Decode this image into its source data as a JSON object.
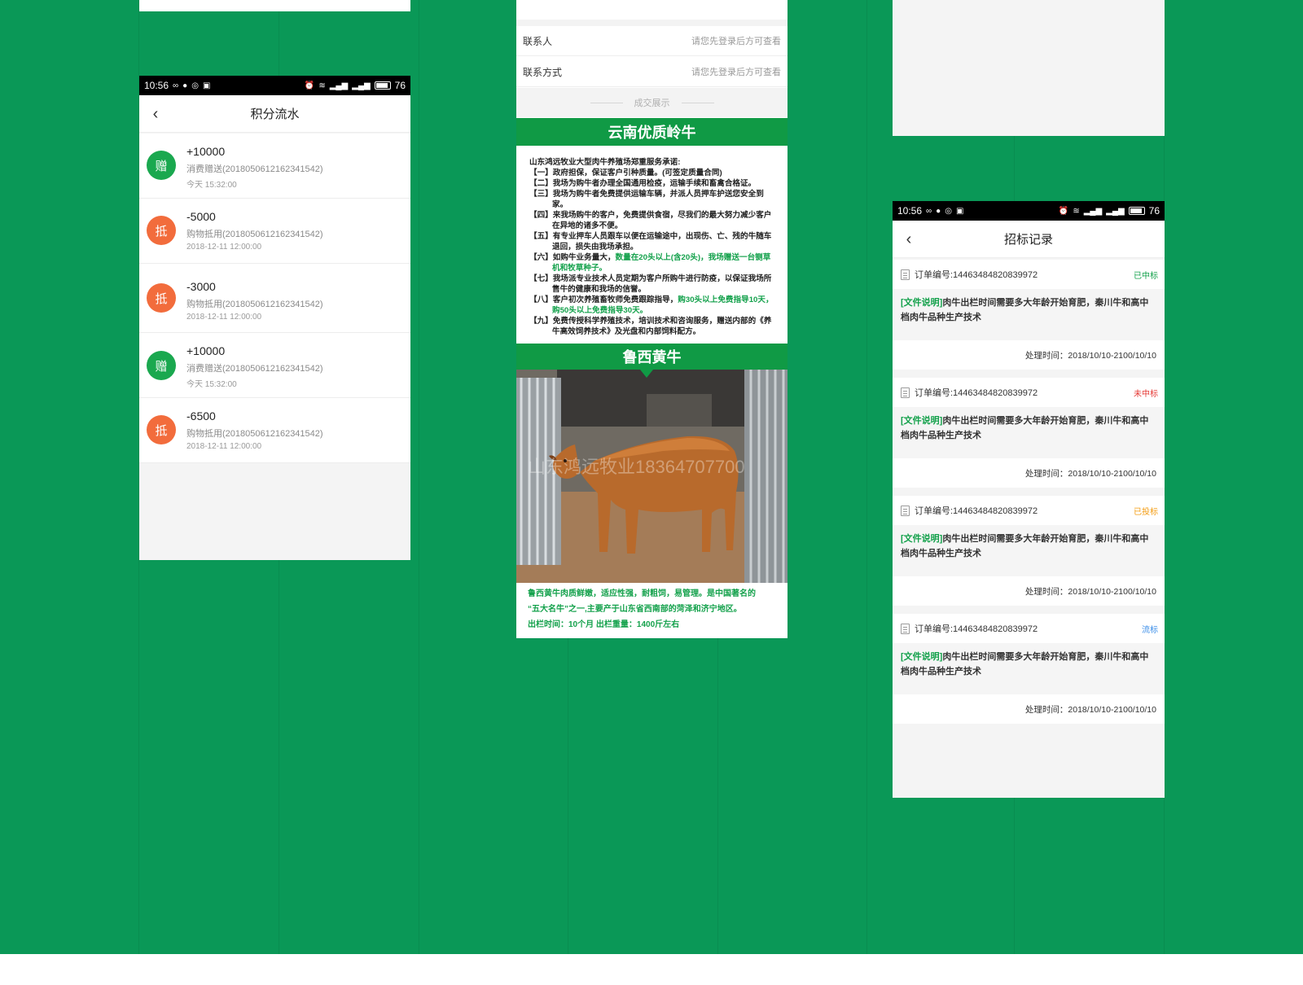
{
  "colors": {
    "background": "#0a9857",
    "accent_green": "#13a14b",
    "badge_gift": "#1aa84f",
    "badge_deduct": "#f26c3c",
    "status_won": "#13a14b",
    "status_lost": "#e53935",
    "status_bid": "#f39c12",
    "status_failed": "#3b8ee8"
  },
  "status_bar": {
    "time": "10:56",
    "battery": "76",
    "left_icons": [
      "infinity-icon",
      "chat-bubble-icon",
      "sync-icon",
      "image-icon"
    ],
    "right_icons": [
      "alarm-icon",
      "wifi-icon",
      "signal-icon",
      "signal-icon",
      "battery-icon"
    ]
  },
  "points_panel": {
    "title": "积分流水",
    "items": [
      {
        "badge": "赠",
        "amount": "+10000",
        "desc": "消费赠送(2018050612162341542)",
        "time": "今天 15:32:00",
        "type": "gift"
      },
      {
        "badge": "抵",
        "amount": "-5000",
        "desc": "购物抵用(2018050612162341542)",
        "time": "2018-12-11 12:00:00",
        "type": "deduct"
      },
      {
        "badge": "抵",
        "amount": "-3000",
        "desc": "购物抵用(2018050612162341542)",
        "time": "2018-12-11 12:00:00",
        "type": "deduct"
      },
      {
        "badge": "赠",
        "amount": "+10000",
        "desc": "消费赠送(2018050612162341542)",
        "time": "今天 15:32:00",
        "type": "gift"
      },
      {
        "badge": "抵",
        "amount": "-6500",
        "desc": "购物抵用(2018050612162341542)",
        "time": "2018-12-11 12:00:00",
        "type": "deduct"
      }
    ]
  },
  "detail_panel": {
    "contact_label": "联系人",
    "contact_value": "请您先登录后方可查看",
    "method_label": "联系方式",
    "method_value": "请您先登录后方可查看",
    "section_label": "成交展示",
    "banner1": "云南优质岭牛",
    "promise_lead": "山东鸿远牧业大型肉牛养殖场郑重服务承诺:",
    "promises": [
      {
        "no": "【一】",
        "text": "政府担保，保证客户引种质量。(可签定质量合同)"
      },
      {
        "no": "【二】",
        "text": "我场为购牛者办理全国通用检疫，运输手续和畜禽合格证。"
      },
      {
        "no": "【三】",
        "text": "我场为购牛者免费提供运输车辆，并派人员押车护送您安全到家。"
      },
      {
        "no": "【四】",
        "text": "来我场购牛的客户，免费提供食宿，尽我们的最大努力减少客户在异地的诸多不便。"
      },
      {
        "no": "【五】",
        "text": "有专业押车人员跟车以便在运输途中，出现伤、亡、残的牛随车退回，损失由我场承担。"
      },
      {
        "no": "【六】",
        "text": "如购牛业务量大，",
        "hl": "数量在20头以上(含20头)，我场赠送一台铡草机和牧草种子。"
      },
      {
        "no": "【七】",
        "text": "我场派专业技术人员定期为客户所购牛进行防疫，以保证我场所售牛的健康和我场的信誉。"
      },
      {
        "no": "【八】",
        "text": "客户初次养殖畜牧师免费跟踪指导，",
        "hl": "购30头以上免费指导10天，购50头以上免费指导30天。"
      },
      {
        "no": "【九】",
        "text": "免费传授科学养殖技术，培训技术和咨询服务，赠送内部的《养牛高效饲养技术》及光盘和内部饲料配方。"
      }
    ],
    "banner2": "鲁西黄牛",
    "watermark": "山东鸿远牧业18364707700",
    "caption_line1": "鲁西黄牛肉质鲜嫩，适应性强，耐粗饲，易管理。是中国著名的",
    "caption_line2": "“五大名牛”之一,主要产于山东省西南部的菏泽和济宁地区。",
    "caption_line3": "出栏时间：10个月     出栏重量：1400斤左右"
  },
  "tender_panel": {
    "title": "招标记录",
    "records": [
      {
        "order": "订单编号:14463484820839972",
        "status": "已中标",
        "status_type": "won",
        "tag": "[文件说明]",
        "text": "肉牛出栏时间需要多大年龄开始育肥，秦川牛和高中档肉牛品种生产技术",
        "time": "处理时间：2018/10/10-2100/10/10"
      },
      {
        "order": "订单编号:14463484820839972",
        "status": "未中标",
        "status_type": "lost",
        "tag": "[文件说明]",
        "text": "肉牛出栏时间需要多大年龄开始育肥，秦川牛和高中档肉牛品种生产技术",
        "time": "处理时间：2018/10/10-2100/10/10"
      },
      {
        "order": "订单编号:14463484820839972",
        "status": "已投标",
        "status_type": "bid",
        "tag": "[文件说明]",
        "text": "肉牛出栏时间需要多大年龄开始育肥，秦川牛和高中档肉牛品种生产技术",
        "time": "处理时间：2018/10/10-2100/10/10"
      },
      {
        "order": "订单编号:14463484820839972",
        "status": "流标",
        "status_type": "failed",
        "tag": "[文件说明]",
        "text": "肉牛出栏时间需要多大年龄开始育肥，秦川牛和高中档肉牛品种生产技术",
        "time": "处理时间：2018/10/10-2100/10/10"
      }
    ]
  }
}
